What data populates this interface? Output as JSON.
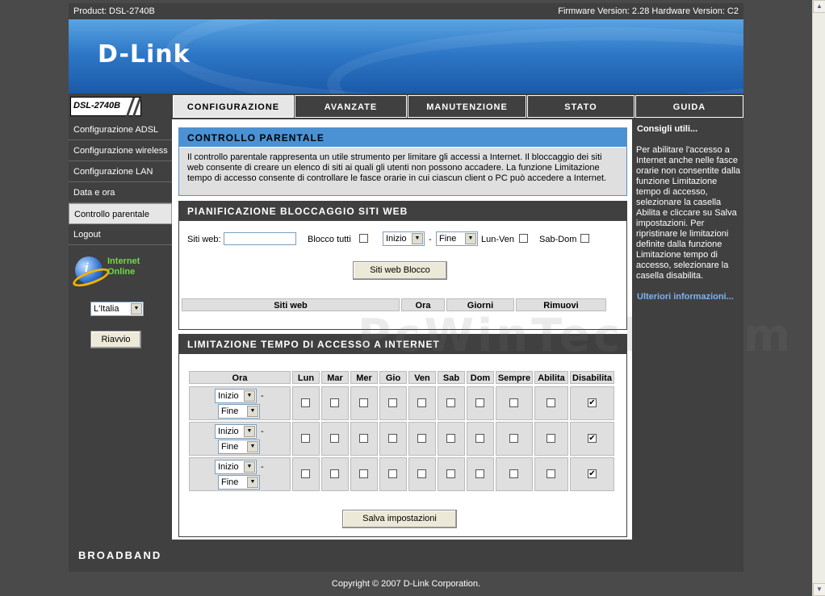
{
  "topbar": {
    "product": "Product: DSL-2740B",
    "versions": "Firmware Version: 2.28 Hardware Version: C2"
  },
  "brand": {
    "logo": "D-Link",
    "model": "DSL-2740B",
    "footer": "BROADBAND",
    "copyright": "Copyright © 2007 D-Link Corporation."
  },
  "tabs": [
    {
      "label": "CONFIGURAZIONE"
    },
    {
      "label": "AVANZATE"
    },
    {
      "label": "MANUTENZIONE"
    },
    {
      "label": "STATO"
    },
    {
      "label": "GUIDA"
    }
  ],
  "sidebar": {
    "items": [
      {
        "label": "Configurazione ADSL"
      },
      {
        "label": "Configurazione wireless"
      },
      {
        "label": "Configurazione LAN"
      },
      {
        "label": "Data e ora"
      },
      {
        "label": "Controllo parentale"
      },
      {
        "label": "Logout"
      }
    ],
    "online_line1": "Internet",
    "online_line2": "Online",
    "language": "L'Italia",
    "reboot": "Riavvio"
  },
  "parental": {
    "title": "CONTROLLO PARENTALE",
    "description": "Il controllo parentale rappresenta un utile strumento per limitare gli accessi a Internet. Il bloccaggio dei siti web consente di creare un elenco di siti ai quali gli utenti non possono accadere. La funzione Limitazione tempo di accesso consente di controllare le fasce orarie in cui ciascun client o PC può accedere a Internet."
  },
  "block": {
    "title": "PIANIFICAZIONE BLOCCAGGIO SITI WEB",
    "site_label": "Siti web:",
    "block_all_label": "Blocco tutti",
    "start": "Inizio",
    "dash": "-",
    "end": "Fine",
    "monfri": "Lun-Ven",
    "satsun": "Sab-Dom",
    "button": "Siti web Blocco",
    "columns": [
      "Siti web",
      "Ora",
      "Giorni",
      "Rimuovi"
    ]
  },
  "limit": {
    "title": "LIMITAZIONE TEMPO DI ACCESSO A INTERNET",
    "columns": [
      "Ora",
      "Lun",
      "Mar",
      "Mer",
      "Gio",
      "Ven",
      "Sab",
      "Dom",
      "Sempre",
      "Abilita",
      "Disabilita"
    ],
    "rows": [
      {
        "start": "Inizio",
        "end": "Fine",
        "disabled": "✔"
      },
      {
        "start": "Inizio",
        "end": "Fine",
        "disabled": "✔"
      },
      {
        "start": "Inizio",
        "end": "Fine",
        "disabled": "✔"
      }
    ],
    "dash": "-",
    "save": "Salva impostazioni"
  },
  "tips": {
    "title": "Consigli utili...",
    "body": "Per abilitare l'accesso a Internet anche nelle fasce orarie non consentite dalla funzione Limitazione tempo di accesso, selezionare la casella Abilita e cliccare su Salva impostazioni. Per ripristinare le limitazioni definite dalla funzione Limitazione tempo di accesso, selezionare la casella disabilita.",
    "more": "Ulteriori informazioni..."
  },
  "watermark": "PcWinTech.com"
}
